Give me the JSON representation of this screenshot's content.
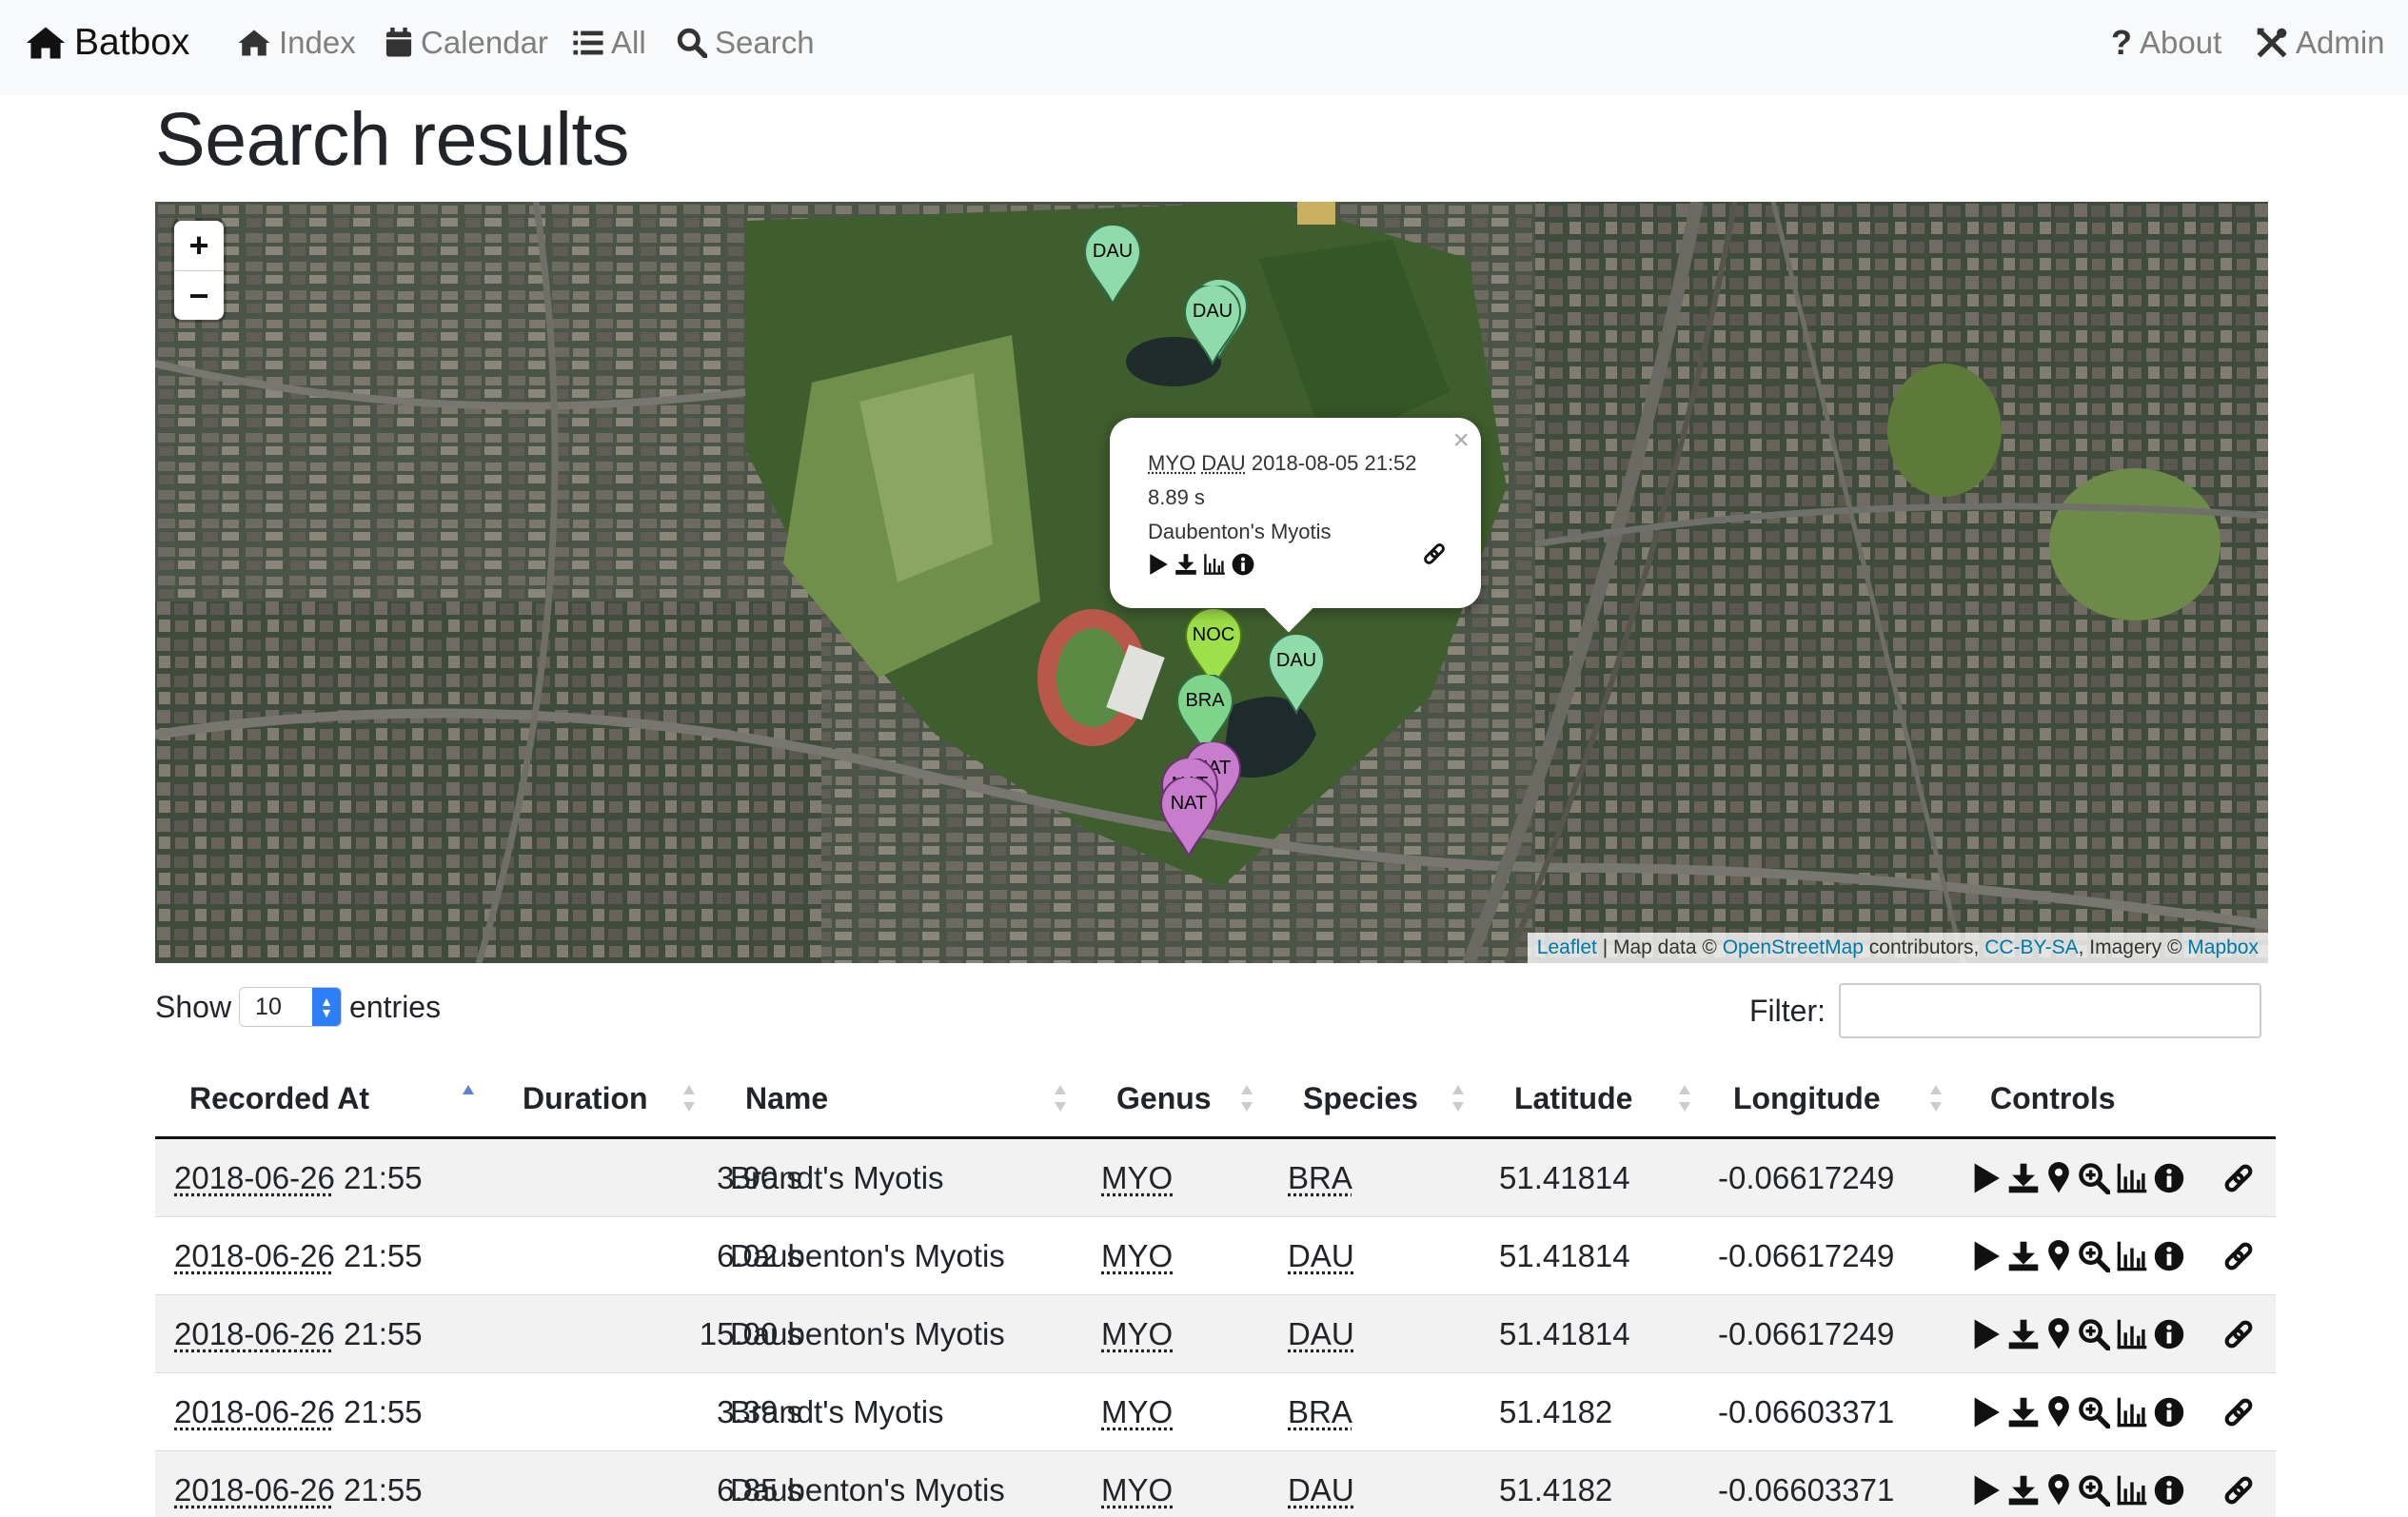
{
  "navbar": {
    "brand": "Batbox",
    "links": [
      {
        "label": "Index",
        "icon": "home-icon"
      },
      {
        "label": "Calendar",
        "icon": "calendar-icon"
      },
      {
        "label": "All",
        "icon": "list-icon"
      },
      {
        "label": "Search",
        "icon": "search-icon"
      }
    ],
    "right_links": [
      {
        "label": "About",
        "icon": "question-icon"
      },
      {
        "label": "Admin",
        "icon": "tools-icon"
      }
    ]
  },
  "page_title": "Search results",
  "map": {
    "zoom_in": "+",
    "zoom_out": "−",
    "markers": [
      "DAU",
      "DAU",
      "DAU",
      "NOC",
      "DAU",
      "BRA",
      "NAT",
      "NAT",
      "NAT"
    ],
    "popup": {
      "genus": "MYO",
      "species": "DAU",
      "datetime": "2018-08-05 21:52",
      "duration": "8.89 s",
      "name": "Daubenton's Myotis",
      "close": "×"
    },
    "attribution": {
      "leaflet": "Leaflet",
      "sep": " | Map data © ",
      "osm": "OpenStreetMap",
      "contributors": " contributors, ",
      "license": "CC-BY-SA",
      "imagery": ", Imagery © ",
      "mapbox": "Mapbox"
    }
  },
  "length_menu": {
    "show": "Show",
    "value": "10",
    "entries": "entries"
  },
  "filter": {
    "label": "Filter:",
    "value": ""
  },
  "table": {
    "columns": [
      "Recorded At",
      "Duration",
      "Name",
      "Genus",
      "Species",
      "Latitude",
      "Longitude",
      "Controls"
    ],
    "rows": [
      {
        "date": "2018-06-26",
        "time": "21:55",
        "duration": "3.90 s",
        "name": "Brandt's Myotis",
        "genus": "MYO",
        "species": "BRA",
        "lat": "51.41814",
        "lon": "-0.06617249"
      },
      {
        "date": "2018-06-26",
        "time": "21:55",
        "duration": "6.02 s",
        "name": "Daubenton's Myotis",
        "genus": "MYO",
        "species": "DAU",
        "lat": "51.41814",
        "lon": "-0.06617249"
      },
      {
        "date": "2018-06-26",
        "time": "21:55",
        "duration": "15.00 s",
        "name": "Daubenton's Myotis",
        "genus": "MYO",
        "species": "DAU",
        "lat": "51.41814",
        "lon": "-0.06617249"
      },
      {
        "date": "2018-06-26",
        "time": "21:55",
        "duration": "3.39 s",
        "name": "Brandt's Myotis",
        "genus": "MYO",
        "species": "BRA",
        "lat": "51.4182",
        "lon": "-0.06603371"
      },
      {
        "date": "2018-06-26",
        "time": "21:55",
        "duration": "6.85 s",
        "name": "Daubenton's Myotis",
        "genus": "MYO",
        "species": "DAU",
        "lat": "51.4182",
        "lon": "-0.06603371"
      }
    ],
    "control_icons": [
      "play-icon",
      "download-icon",
      "map-pin-icon",
      "zoom-icon",
      "spectrogram-icon",
      "info-icon",
      "link-icon"
    ]
  },
  "colors": {
    "marker_dau": "#8fdcaa",
    "marker_noc": "#9ee04a",
    "marker_bra": "#7fd48c",
    "marker_nat": "#c77dcc",
    "link": "#0078a8",
    "navbar_bg": "#f8f9fa"
  }
}
